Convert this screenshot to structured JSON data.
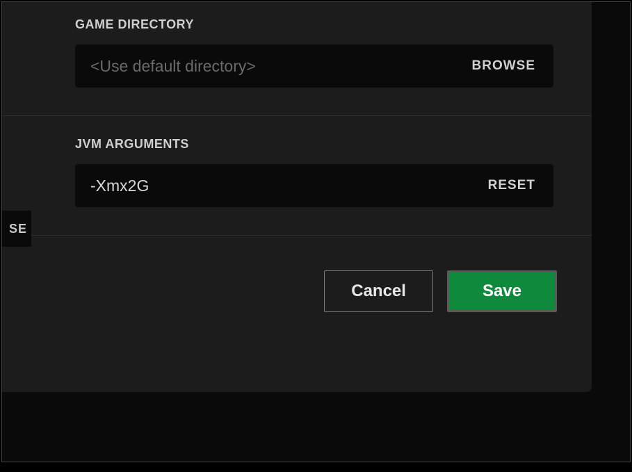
{
  "sections": {
    "gameDirectory": {
      "label": "GAME DIRECTORY",
      "value": "",
      "placeholder": "<Use default directory>",
      "action": "BROWSE"
    },
    "jvmArguments": {
      "label": "JVM ARGUMENTS",
      "value": "-Xmx2G",
      "action": "RESET"
    }
  },
  "leftFragment": "SE",
  "buttons": {
    "cancel": "Cancel",
    "save": "Save"
  }
}
